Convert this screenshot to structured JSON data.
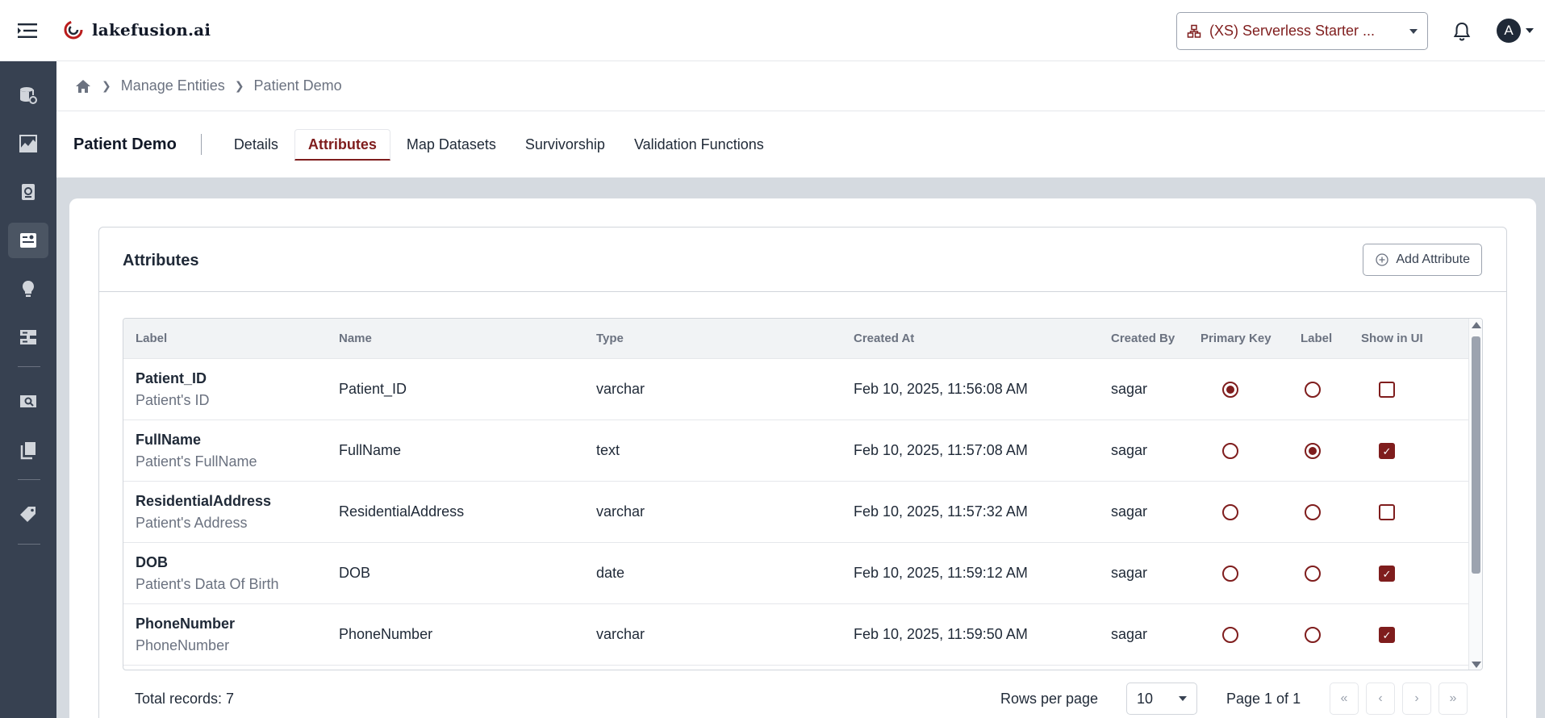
{
  "app": {
    "name": "lakefusion.ai"
  },
  "header": {
    "workspace_label": "(XS) Serverless Starter ...",
    "avatar_initial": "A"
  },
  "breadcrumb": {
    "items": [
      "Manage Entities",
      "Patient Demo"
    ]
  },
  "entity": {
    "title": "Patient Demo",
    "tabs": [
      "Details",
      "Attributes",
      "Map Datasets",
      "Survivorship",
      "Validation Functions"
    ],
    "active_tab": "Attributes"
  },
  "card": {
    "title": "Attributes",
    "add_button": "Add Attribute"
  },
  "table": {
    "columns": [
      "Label",
      "Name",
      "Type",
      "Created At",
      "Created By",
      "Primary Key",
      "Label",
      "Show in UI"
    ],
    "rows": [
      {
        "label": "Patient_ID",
        "description": "Patient's ID",
        "name": "Patient_ID",
        "type": "varchar",
        "created_at": "Feb 10, 2025, 11:56:08 AM",
        "created_by": "sagar",
        "primary_key": true,
        "is_label": false,
        "show_in_ui": false
      },
      {
        "label": "FullName",
        "description": "Patient's FullName",
        "name": "FullName",
        "type": "text",
        "created_at": "Feb 10, 2025, 11:57:08 AM",
        "created_by": "sagar",
        "primary_key": false,
        "is_label": true,
        "show_in_ui": true
      },
      {
        "label": "ResidentialAddress",
        "description": "Patient's Address",
        "name": "ResidentialAddress",
        "type": "varchar",
        "created_at": "Feb 10, 2025, 11:57:32 AM",
        "created_by": "sagar",
        "primary_key": false,
        "is_label": false,
        "show_in_ui": false
      },
      {
        "label": "DOB",
        "description": "Patient's Data Of Birth",
        "name": "DOB",
        "type": "date",
        "created_at": "Feb 10, 2025, 11:59:12 AM",
        "created_by": "sagar",
        "primary_key": false,
        "is_label": false,
        "show_in_ui": true
      },
      {
        "label": "PhoneNumber",
        "description": "PhoneNumber",
        "name": "PhoneNumber",
        "type": "varchar",
        "created_at": "Feb 10, 2025, 11:59:50 AM",
        "created_by": "sagar",
        "primary_key": false,
        "is_label": false,
        "show_in_ui": true
      }
    ]
  },
  "footer": {
    "total_records": "Total records: 7",
    "rows_per_page_label": "Rows per page",
    "rows_per_page": "10",
    "page_info": "Page 1 of 1"
  },
  "colors": {
    "brand": "#7f1d1d",
    "sidebar": "#374151"
  },
  "icons": {
    "sidebar": [
      "database-icon",
      "chart-icon",
      "notebook-icon",
      "entity-icon",
      "lightbulb-icon",
      "server-icon",
      "search-report-icon",
      "copy-icon",
      "tag-icon"
    ]
  }
}
